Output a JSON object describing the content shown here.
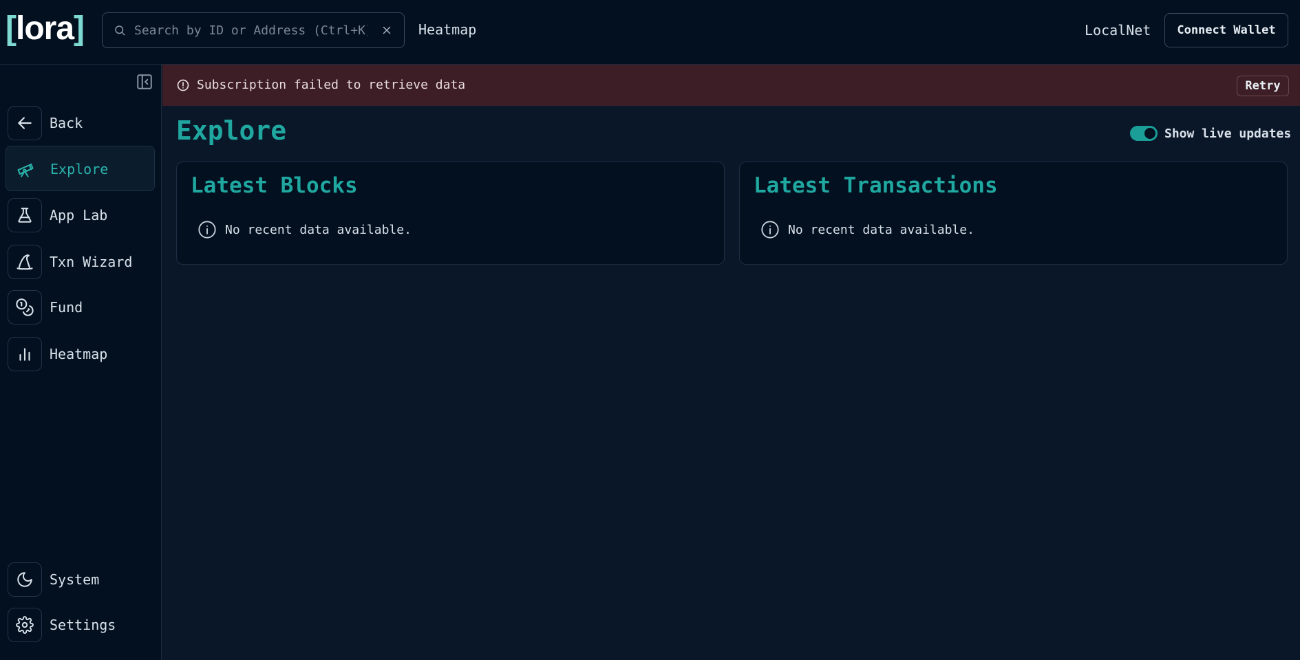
{
  "header": {
    "logo": {
      "left_bracket": "[",
      "word": "lora",
      "right_bracket": "]"
    },
    "search": {
      "placeholder": "Search by ID or Address (Ctrl+K)",
      "value": ""
    },
    "nav_link": "Heatmap",
    "network": "LocalNet",
    "connect_wallet": "Connect Wallet"
  },
  "sidebar": {
    "items": [
      {
        "label": "Back",
        "icon": "arrow-left-icon"
      },
      {
        "label": "Explore",
        "icon": "telescope-icon",
        "active": true
      },
      {
        "label": "App Lab",
        "icon": "flask-icon"
      },
      {
        "label": "Txn Wizard",
        "icon": "wizard-hat-icon"
      },
      {
        "label": "Fund",
        "icon": "coins-icon"
      },
      {
        "label": "Heatmap",
        "icon": "bar-chart-icon"
      }
    ],
    "bottom_items": [
      {
        "label": "System",
        "icon": "moon-icon"
      },
      {
        "label": "Settings",
        "icon": "gear-icon"
      }
    ]
  },
  "banner": {
    "message": "Subscription failed to retrieve data",
    "retry": "Retry"
  },
  "main": {
    "title": "Explore",
    "live_updates_label": "Show live updates",
    "live_updates_on": true,
    "cards": [
      {
        "title": "Latest Blocks",
        "message": "No recent data available."
      },
      {
        "title": "Latest Transactions",
        "message": "No recent data available."
      }
    ]
  },
  "colors": {
    "accent": "#1fa7a0",
    "background": "#0a1728",
    "header_bg": "#02101f",
    "error_banner": "#3d1d26"
  }
}
